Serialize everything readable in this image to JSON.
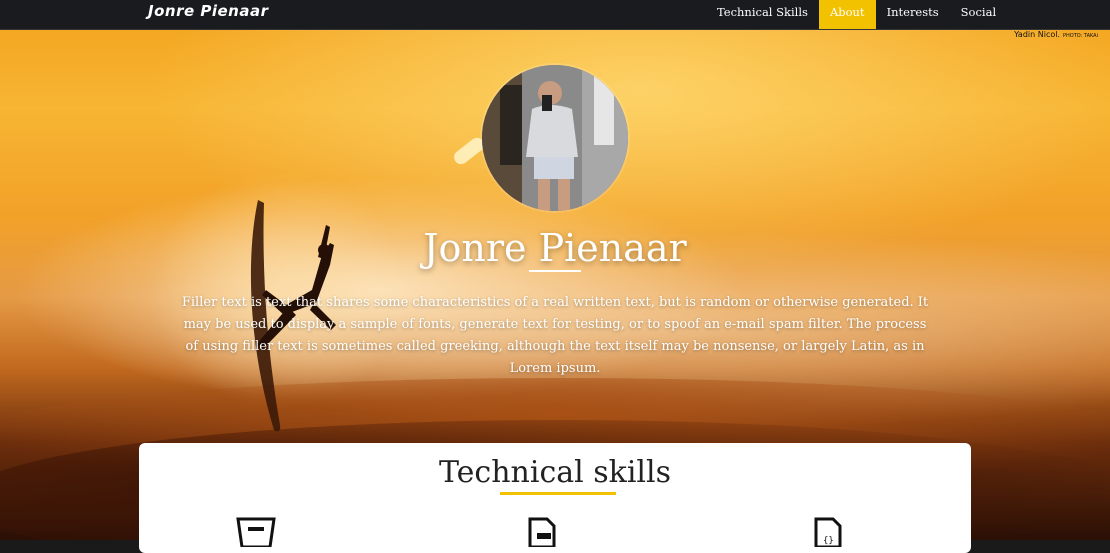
{
  "navbar": {
    "brand": "Jonre Pienaar",
    "links": [
      {
        "label": "Technical Skills",
        "active": false
      },
      {
        "label": "About",
        "active": true
      },
      {
        "label": "Interests",
        "active": false
      },
      {
        "label": "Social",
        "active": false
      }
    ]
  },
  "photo_credit": {
    "name": "Yadin Nicol.",
    "note": "PHOTO: TAKAi"
  },
  "hero": {
    "name": "Jonre Pienaar",
    "bio": "Filler text is text that shares some characteristics of a real written text, but is random or otherwise generated. It may be used to display a sample of fonts, generate text for testing, or to spoof an e-mail spam filter. The process of using filler text is sometimes called greeking, although the text itself may be nonsense, or largely Latin, as in Lorem ipsum."
  },
  "skills": {
    "title": "Technical skills",
    "icons": [
      "html5-icon",
      "file-image-icon",
      "file-code-icon"
    ]
  },
  "colors": {
    "accent": "#f2c200",
    "navbar_bg": "#1a1b1f"
  }
}
